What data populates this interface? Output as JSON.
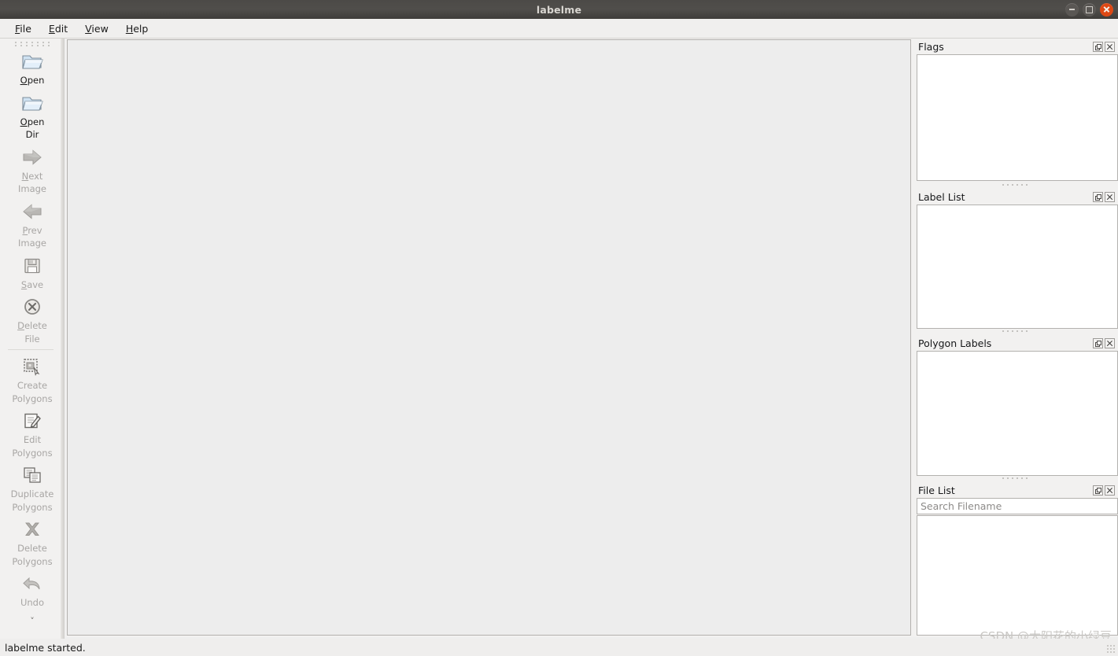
{
  "window": {
    "title": "labelme",
    "controls": [
      {
        "name": "minimize-button",
        "icon": "minimize-icon"
      },
      {
        "name": "maximize-button",
        "icon": "maximize-icon"
      },
      {
        "name": "close-button",
        "icon": "close-icon",
        "color": "#dd4814"
      }
    ]
  },
  "menubar": {
    "items": [
      {
        "label": "File",
        "mnemonic": "F"
      },
      {
        "label": "Edit",
        "mnemonic": "E"
      },
      {
        "label": "View",
        "mnemonic": "V"
      },
      {
        "label": "Help",
        "mnemonic": "H"
      }
    ]
  },
  "toolbar": {
    "items": [
      {
        "id": "open",
        "lines": [
          "Open"
        ],
        "mnemonic": "O",
        "icon": "open-folder-icon",
        "enabled": true
      },
      {
        "id": "open-dir",
        "lines": [
          "Open",
          "Dir"
        ],
        "mnemonic": "O",
        "icon": "open-folder-icon",
        "enabled": true
      },
      {
        "id": "next-image",
        "lines": [
          "Next",
          "Image"
        ],
        "mnemonic": "N",
        "icon": "arrow-right-icon",
        "enabled": false
      },
      {
        "id": "prev-image",
        "lines": [
          "Prev",
          "Image"
        ],
        "mnemonic": "P",
        "icon": "arrow-left-icon",
        "enabled": false
      },
      {
        "id": "save",
        "lines": [
          "Save"
        ],
        "mnemonic": "S",
        "icon": "save-floppy-icon",
        "enabled": false
      },
      {
        "id": "delete-file",
        "lines": [
          "Delete",
          "File"
        ],
        "mnemonic": "D",
        "icon": "delete-circle-x-icon",
        "enabled": false
      },
      {
        "id": "create-polygons",
        "lines": [
          "Create",
          "Polygons"
        ],
        "mnemonic": "",
        "icon": "create-polygon-icon",
        "enabled": false
      },
      {
        "id": "edit-polygons",
        "lines": [
          "Edit",
          "Polygons"
        ],
        "mnemonic": "",
        "icon": "edit-pencil-icon",
        "enabled": false
      },
      {
        "id": "duplicate-polygons",
        "lines": [
          "Duplicate",
          "Polygons"
        ],
        "mnemonic": "",
        "icon": "duplicate-copy-icon",
        "enabled": false
      },
      {
        "id": "delete-polygons",
        "lines": [
          "Delete",
          "Polygons"
        ],
        "mnemonic": "",
        "icon": "delete-x-icon",
        "enabled": false
      },
      {
        "id": "undo",
        "lines": [
          "Undo"
        ],
        "mnemonic": "",
        "icon": "undo-arrow-icon",
        "enabled": false
      }
    ],
    "expand_label": "˅"
  },
  "dock": {
    "panels": [
      {
        "id": "flags",
        "title": "Flags",
        "has_search": false,
        "items": []
      },
      {
        "id": "label-list",
        "title": "Label List",
        "has_search": false,
        "items": []
      },
      {
        "id": "polygon-labels",
        "title": "Polygon Labels",
        "has_search": false,
        "items": []
      },
      {
        "id": "file-list",
        "title": "File List",
        "has_search": true,
        "search_placeholder": "Search Filename",
        "search_value": "",
        "items": []
      }
    ],
    "buttons": {
      "float": "float-icon",
      "close": "close-icon"
    }
  },
  "statusbar": {
    "message": "labelme started."
  },
  "watermark": {
    "text": "CSDN @太阳花的小绿豆"
  },
  "colors": {
    "titlebar": "#4c4a47",
    "close_button": "#dd4814",
    "chrome": "#f2f1f0",
    "canvas": "#ededed",
    "panel_body": "#ffffff",
    "border": "#b3b1ae",
    "disabled_text": "#a8a6a4"
  }
}
